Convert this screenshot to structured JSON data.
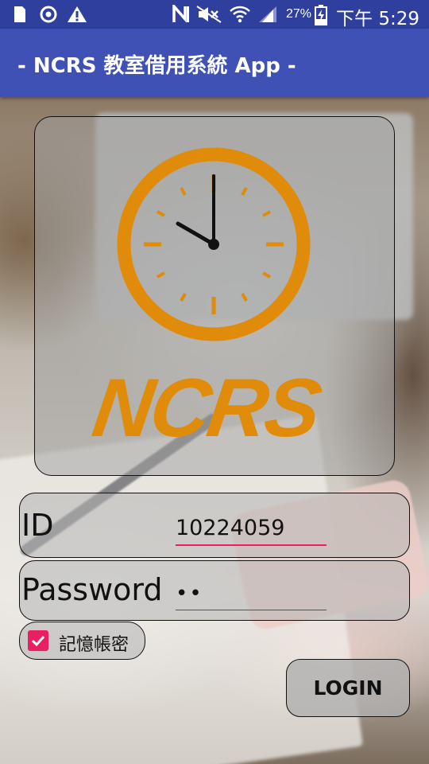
{
  "status_bar": {
    "battery_percent": "27%",
    "clock": "下午 5:29",
    "icons": [
      "sim-card-icon",
      "sync-icon",
      "warning-icon",
      "nfc-icon",
      "mute-icon",
      "wifi-icon",
      "signal-icon",
      "battery-charging-icon"
    ]
  },
  "app_bar": {
    "title": "- NCRS 教室借用系統 App -"
  },
  "logo": {
    "text": "NCRS",
    "icon": "clock-icon",
    "color": "#e08b0a"
  },
  "form": {
    "id_label": "ID",
    "id_value": "10224059",
    "password_label": "Password",
    "password_value": "••",
    "remember_label": "記憶帳密",
    "remember_checked": true,
    "login_label": "LOGIN"
  },
  "colors": {
    "status_bar": "#2f3f9e",
    "app_bar": "#3f51b5",
    "accent": "#e91e63",
    "logo_orange": "#e08b0a"
  }
}
